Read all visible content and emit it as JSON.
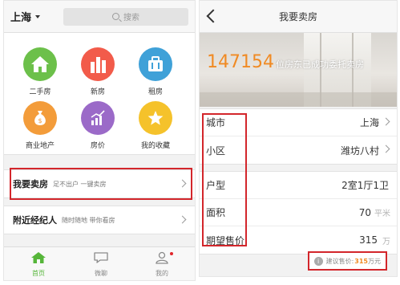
{
  "left_screen": {
    "city": "上海",
    "search_placeholder": "搜索",
    "grid_items": [
      {
        "label": "二手房",
        "icon": "house-icon",
        "color": "#6cc04a"
      },
      {
        "label": "新房",
        "icon": "buildings-icon",
        "color": "#f25b4a"
      },
      {
        "label": "租房",
        "icon": "suitcase-icon",
        "color": "#3fa1d8"
      },
      {
        "label": "商业地产",
        "icon": "money-bag-icon",
        "color": "#f39c3a"
      },
      {
        "label": "房价",
        "icon": "trend-chart-icon",
        "color": "#9b6ac8"
      },
      {
        "label": "我的收藏",
        "icon": "star-icon",
        "color": "#f5c22b"
      }
    ],
    "rows": [
      {
        "title": "我要卖房",
        "subtitle": "足不出户 一键卖房"
      },
      {
        "title": "附近经纪人",
        "subtitle": "随时随地 带你看房"
      }
    ],
    "tabs": [
      {
        "label": "首页",
        "icon": "home-icon",
        "active": true
      },
      {
        "label": "微聊",
        "icon": "chat-bubble-icon",
        "active": false
      },
      {
        "label": "我的",
        "icon": "person-icon",
        "active": false
      }
    ]
  },
  "right_screen": {
    "title": "我要卖房",
    "banner_count": "147154",
    "banner_text": "位房东已成功委托卖房",
    "fields_group1": [
      {
        "label": "城市",
        "value": "上海"
      },
      {
        "label": "小区",
        "value": "潍坊八村"
      }
    ],
    "fields_group2": [
      {
        "label": "户型",
        "value": "2室1厅1卫",
        "unit": ""
      },
      {
        "label": "面积",
        "value": "70",
        "unit": "平米"
      },
      {
        "label": "期望售价",
        "value": "315",
        "unit": "万"
      }
    ],
    "suggest_label": "建议售价:",
    "suggest_value": "315",
    "suggest_unit": "万元",
    "info_glyph": "i"
  },
  "colors": {
    "highlight": "#d3262b",
    "accent_orange": "#f08a23",
    "active_tab": "#56b63a"
  }
}
